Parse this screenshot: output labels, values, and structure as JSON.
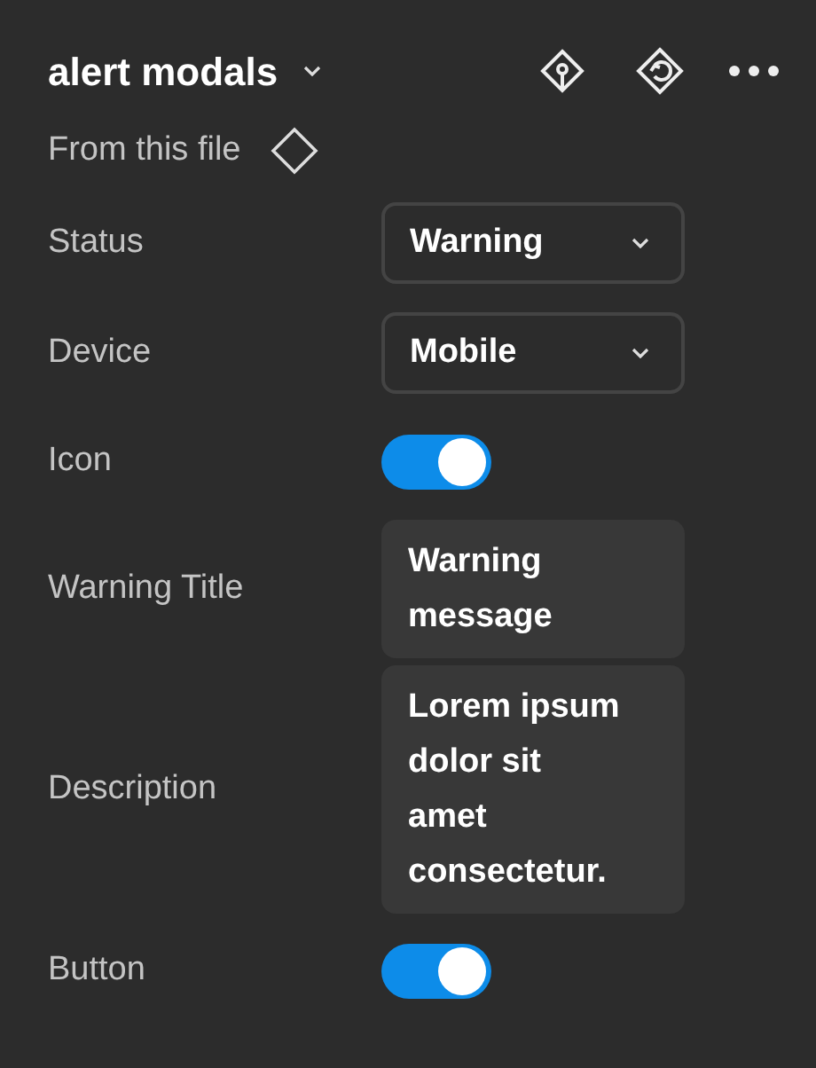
{
  "header": {
    "title": "alert modals",
    "source": "From this file"
  },
  "properties": [
    {
      "kind": "select",
      "label": "Status",
      "value": "Warning"
    },
    {
      "kind": "select",
      "label": "Device",
      "value": "Mobile"
    },
    {
      "kind": "toggle",
      "label": "Icon",
      "on": true
    },
    {
      "kind": "text",
      "label": "Warning Title",
      "value": "Warning\nmessage"
    },
    {
      "kind": "text",
      "label": "Description",
      "value": "Lorem ipsum\ndolor sit\namet\nconsectetur."
    },
    {
      "kind": "toggle",
      "label": "Button",
      "on": true
    }
  ]
}
